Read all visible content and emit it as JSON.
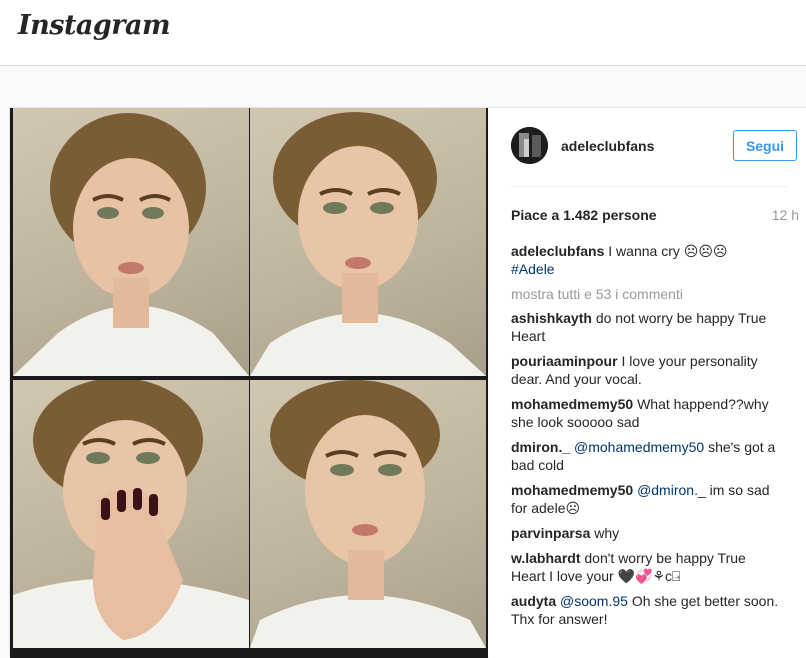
{
  "app": {
    "logo": "Instagram"
  },
  "post": {
    "username": "adeleclubfans",
    "follow_label": "Segui",
    "likes_text": "Piace a 1.482 persone",
    "time_ago": "12 h",
    "caption": {
      "author": "adeleclubfans",
      "text": "I wanna cry ☹☹☹",
      "hashtag": "#Adele"
    },
    "view_all_comments": "mostra tutti e 53 i commenti",
    "comments": [
      {
        "author": "ashishkayth",
        "text": "do not worry be happy True Heart"
      },
      {
        "author": "pouriaaminpour",
        "text": "I love your personality dear. And your vocal."
      },
      {
        "author": "mohamedmemy50",
        "text": "What happend??why she look sooooo sad"
      },
      {
        "author": "dmiron._",
        "mention": "@mohamedmemy50",
        "text": "she's got a bad cold"
      },
      {
        "author": "mohamedmemy50",
        "mention": "@dmiron._",
        "text": "im so sad for adele☹"
      },
      {
        "author": "parvinparsa",
        "text": "why"
      },
      {
        "author": "w.labhardt",
        "text": "don't worry be happy True Heart I love your 🖤💞⚘c⍈"
      },
      {
        "author": "audyta",
        "mention": "@soom.95",
        "text": "Oh she get better soon. Thx for answer!"
      }
    ]
  },
  "colors": {
    "accent": "#3897f0",
    "link": "#003569",
    "muted": "#999999"
  },
  "icons": {
    "avatar": "avatar-image"
  }
}
